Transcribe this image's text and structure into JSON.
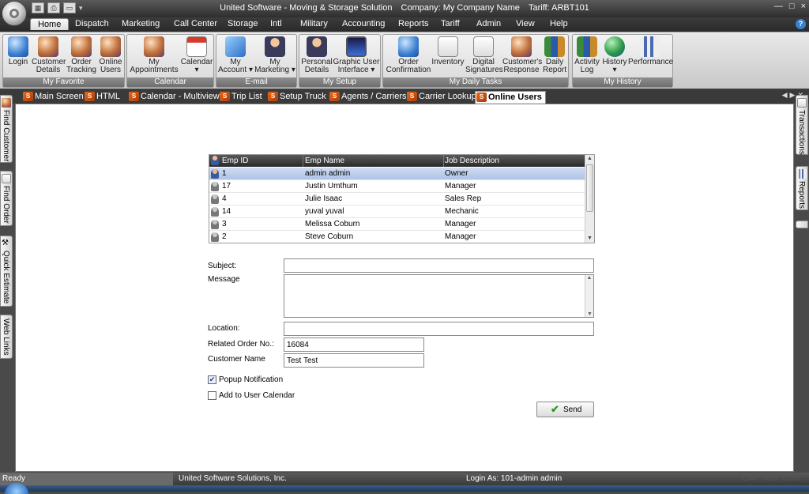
{
  "window": {
    "app_title": "United Software - Moving & Storage Solution",
    "company": "Company: My Company Name",
    "tariff": "Tariff: ARBT101",
    "controls": {
      "minimize": "—",
      "maximize": "□",
      "close": "×"
    }
  },
  "ribbon_tabs": [
    {
      "label": "Home",
      "active": true
    },
    {
      "label": "Dispatch"
    },
    {
      "label": "Marketing"
    },
    {
      "label": "Call Center"
    },
    {
      "label": "Storage"
    },
    {
      "label": "Intl"
    },
    {
      "label": "Military"
    },
    {
      "label": "Accounting"
    },
    {
      "label": "Reports"
    },
    {
      "label": "Tariff"
    },
    {
      "label": "Admin"
    },
    {
      "label": "View"
    },
    {
      "label": "Help"
    }
  ],
  "ribbon_groups": {
    "my_favorite": {
      "label": "My Favorite",
      "buttons": [
        {
          "label": "Login",
          "icon": "login-icon"
        },
        {
          "label": "Customer\nDetails",
          "icon": "customer-details-icon"
        },
        {
          "label": "Order\nTracking",
          "icon": "order-tracking-icon"
        },
        {
          "label": "Online\nUsers",
          "icon": "online-users-icon"
        }
      ]
    },
    "calendar": {
      "label": "Calendar",
      "buttons": [
        {
          "label": "My\nAppointments",
          "icon": "appointments-icon"
        },
        {
          "label": "Calendar\n▾",
          "icon": "calendar-icon"
        }
      ]
    },
    "email": {
      "label": "E-mail",
      "buttons": [
        {
          "label": "My\nAccount ▾",
          "icon": "mail-account-icon"
        },
        {
          "label": "My\nMarketing ▾",
          "icon": "marketing-icon"
        }
      ]
    },
    "my_setup": {
      "label": "My Setup",
      "buttons": [
        {
          "label": "Personal\nDetails",
          "icon": "personal-details-icon"
        },
        {
          "label": "Graphic User\nInterface ▾",
          "icon": "gui-icon"
        }
      ]
    },
    "daily_tasks": {
      "label": "My Daily Tasks",
      "buttons": [
        {
          "label": "Order\nConfirmation",
          "icon": "order-confirmation-icon"
        },
        {
          "label": "Inventory",
          "icon": "inventory-icon"
        },
        {
          "label": "Digital\nSignatures",
          "icon": "digital-signatures-icon"
        },
        {
          "label": "Customer's\nResponse",
          "icon": "customer-response-icon"
        },
        {
          "label": "Daily\nReport",
          "icon": "daily-report-icon"
        }
      ]
    },
    "my_history": {
      "label": "My History",
      "buttons": [
        {
          "label": "Activity\nLog",
          "icon": "activity-log-icon"
        },
        {
          "label": "History\n▾",
          "icon": "history-icon"
        },
        {
          "label": "Performance",
          "icon": "performance-icon"
        }
      ]
    }
  },
  "doc_tabs": [
    {
      "label": "Main Screen"
    },
    {
      "label": "HTML"
    },
    {
      "label": "Calendar - Multiview"
    },
    {
      "label": "Trip List"
    },
    {
      "label": "Setup Truck"
    },
    {
      "label": "Agents / Carriers"
    },
    {
      "label": "Carrier Lookup"
    },
    {
      "label": "Online Users",
      "active": true
    }
  ],
  "side_tabs_left": [
    {
      "label": "Find Customer"
    },
    {
      "label": "Find Order"
    },
    {
      "label": "Quick Estimate"
    },
    {
      "label": "Web Links"
    }
  ],
  "side_tabs_right": [
    {
      "label": "Transactions"
    },
    {
      "label": "Reports"
    }
  ],
  "users_grid": {
    "columns": [
      "Emp ID",
      "Emp Name",
      "Job Description"
    ],
    "rows": [
      {
        "id": "1",
        "name": "admin admin",
        "job": "Owner",
        "selected": true
      },
      {
        "id": "17",
        "name": "Justin Umthum",
        "job": "Manager"
      },
      {
        "id": "4",
        "name": "Julie Isaac",
        "job": "Sales Rep"
      },
      {
        "id": "14",
        "name": "yuval yuval",
        "job": "Mechanic"
      },
      {
        "id": "3",
        "name": "Melissa Coburn",
        "job": "Manager"
      },
      {
        "id": "2",
        "name": "Steve Coburn",
        "job": "Manager"
      }
    ]
  },
  "form": {
    "subject_label": "Subject:",
    "subject_value": "",
    "message_label": "Message",
    "message_value": "",
    "location_label": "Location:",
    "location_value": "",
    "order_label": "Related Order No.:",
    "order_value": "16084",
    "customer_label": "Customer Name",
    "customer_value": "Test Test",
    "popup_label": "Popup Notification",
    "popup_checked": true,
    "calendar_label": "Add to User Calendar",
    "calendar_checked": false,
    "send_label": "Send"
  },
  "status": {
    "ready": "Ready",
    "company": "United Software Solutions, Inc.",
    "login": "Login As: 101-admin admin",
    "faded": "CAP NUM SCRL"
  }
}
